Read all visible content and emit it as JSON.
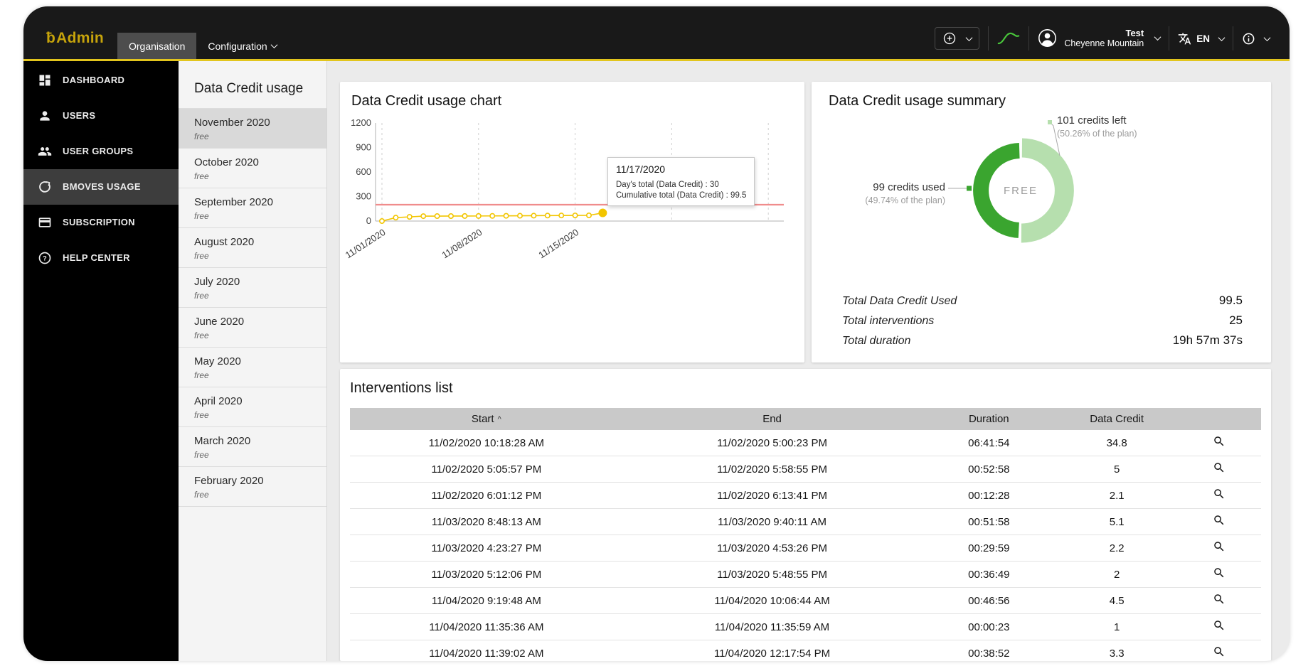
{
  "topbar": {
    "brand": {
      "icon": "ƀ",
      "text": "Admin"
    },
    "nav": [
      {
        "label": "Organisation",
        "active": true
      },
      {
        "label": "Configuration",
        "has_dropdown": true
      }
    ],
    "user": {
      "line1": "Test",
      "line2": "Cheyenne Mountain"
    },
    "language": "EN"
  },
  "icons": {
    "add-icon": "circled-plus",
    "chevron-down-icon": "thin-chevron-down",
    "usage-curve-icon": "green-rising-curve",
    "user-icon": "person-in-circle",
    "translate-icon": "translate-glyph",
    "info-icon": "circled-i",
    "dashboard-icon": "grid-tiles",
    "users-icon": "person",
    "user-groups-icon": "two-people",
    "bmoves-usage-icon": "circular-arc",
    "subscription-icon": "card",
    "help-icon": "circled-question",
    "search-icon": "magnifier",
    "sort-asc-icon": "caret-up"
  },
  "sidebar": {
    "items": [
      {
        "label": "DASHBOARD",
        "icon": "dashboard-icon"
      },
      {
        "label": "USERS",
        "icon": "users-icon"
      },
      {
        "label": "USER GROUPS",
        "icon": "user-groups-icon"
      },
      {
        "label": "BMOVES USAGE",
        "icon": "bmoves-usage-icon",
        "active": true
      },
      {
        "label": "SUBSCRIPTION",
        "icon": "subscription-icon"
      },
      {
        "label": "HELP CENTER",
        "icon": "help-icon"
      }
    ]
  },
  "months_panel": {
    "title": "Data Credit usage",
    "items": [
      {
        "label": "November 2020",
        "sub": "free",
        "selected": true
      },
      {
        "label": "October 2020",
        "sub": "free"
      },
      {
        "label": "September 2020",
        "sub": "free"
      },
      {
        "label": "August 2020",
        "sub": "free"
      },
      {
        "label": "July 2020",
        "sub": "free"
      },
      {
        "label": "June 2020",
        "sub": "free"
      },
      {
        "label": "May 2020",
        "sub": "free"
      },
      {
        "label": "April 2020",
        "sub": "free"
      },
      {
        "label": "March 2020",
        "sub": "free"
      },
      {
        "label": "February 2020",
        "sub": "free"
      }
    ]
  },
  "chart_card": {
    "title": "Data Credit usage chart",
    "tooltip": {
      "title": "11/17/2020",
      "line1": "Day's total (Data Credit) : 30",
      "line2": "Cumulative total (Data Credit) : 99.5"
    }
  },
  "summary_card": {
    "title": "Data Credit usage summary",
    "gauge_center": "FREE",
    "left_annotation": {
      "line1": "101 credits left",
      "line2": "(50.26% of the plan)"
    },
    "used_annotation": {
      "line1": "99 credits used",
      "line2": "(49.74% of the plan)"
    },
    "totals": [
      {
        "label": "Total Data Credit Used",
        "value": "99.5"
      },
      {
        "label": "Total interventions",
        "value": "25"
      },
      {
        "label": "Total duration",
        "value": "19h 57m 37s"
      }
    ]
  },
  "interventions": {
    "title": "Interventions list",
    "columns": [
      "Start",
      "End",
      "Duration",
      "Data Credit"
    ],
    "sort_indicator": "^",
    "rows": [
      {
        "start": "11/02/2020 10:18:28 AM",
        "end": "11/02/2020 5:00:23 PM",
        "duration": "06:41:54",
        "credit": "34.8"
      },
      {
        "start": "11/02/2020 5:05:57 PM",
        "end": "11/02/2020 5:58:55 PM",
        "duration": "00:52:58",
        "credit": "5"
      },
      {
        "start": "11/02/2020 6:01:12 PM",
        "end": "11/02/2020 6:13:41 PM",
        "duration": "00:12:28",
        "credit": "2.1"
      },
      {
        "start": "11/03/2020 8:48:13 AM",
        "end": "11/03/2020 9:40:11 AM",
        "duration": "00:51:58",
        "credit": "5.1"
      },
      {
        "start": "11/03/2020 4:23:27 PM",
        "end": "11/03/2020 4:53:26 PM",
        "duration": "00:29:59",
        "credit": "2.2"
      },
      {
        "start": "11/03/2020 5:12:06 PM",
        "end": "11/03/2020 5:48:55 PM",
        "duration": "00:36:49",
        "credit": "2"
      },
      {
        "start": "11/04/2020 9:19:48 AM",
        "end": "11/04/2020 10:06:44 AM",
        "duration": "00:46:56",
        "credit": "4.5"
      },
      {
        "start": "11/04/2020 11:35:36 AM",
        "end": "11/04/2020 11:35:59 AM",
        "duration": "00:00:23",
        "credit": "1"
      },
      {
        "start": "11/04/2020 11:39:02 AM",
        "end": "11/04/2020 12:17:54 PM",
        "duration": "00:38:52",
        "credit": "3.3"
      }
    ]
  },
  "chart_data": [
    {
      "type": "line",
      "title": "Data Credit usage chart",
      "series_name": "Cumulative total (Data Credit)",
      "x": [
        "11/01/2020",
        "11/02/2020",
        "11/03/2020",
        "11/04/2020",
        "11/05/2020",
        "11/06/2020",
        "11/07/2020",
        "11/08/2020",
        "11/09/2020",
        "11/10/2020",
        "11/11/2020",
        "11/12/2020",
        "11/13/2020",
        "11/14/2020",
        "11/15/2020",
        "11/16/2020",
        "11/17/2020"
      ],
      "values": [
        0,
        41.9,
        51.2,
        60.0,
        60.5,
        61.0,
        61.5,
        62.0,
        63.0,
        64.0,
        65.0,
        66.0,
        67.0,
        68.0,
        69.0,
        69.5,
        99.5
      ],
      "ylim": [
        0,
        1200
      ],
      "yticks": [
        0,
        300,
        600,
        900,
        1200
      ],
      "x_range_days": 30,
      "xtick_days": [
        1,
        8,
        15,
        22,
        29
      ],
      "xtick_labels": [
        "11/01/2020",
        "11/08/2020",
        "11/15/2020",
        "",
        ""
      ],
      "limit_line": 200,
      "limit_color": "#f08c8c",
      "series_color": "#f2c500",
      "grid": true,
      "legend": "none"
    },
    {
      "type": "donut",
      "title": "Data Credit usage summary",
      "center_label": "FREE",
      "total_plan": 200,
      "slices": [
        {
          "label": "credits used",
          "value": 99,
          "pct": 49.74,
          "color": "#3aa52f"
        },
        {
          "label": "credits left",
          "value": 101,
          "pct": 50.26,
          "color": "#b6dfae"
        }
      ]
    }
  ]
}
